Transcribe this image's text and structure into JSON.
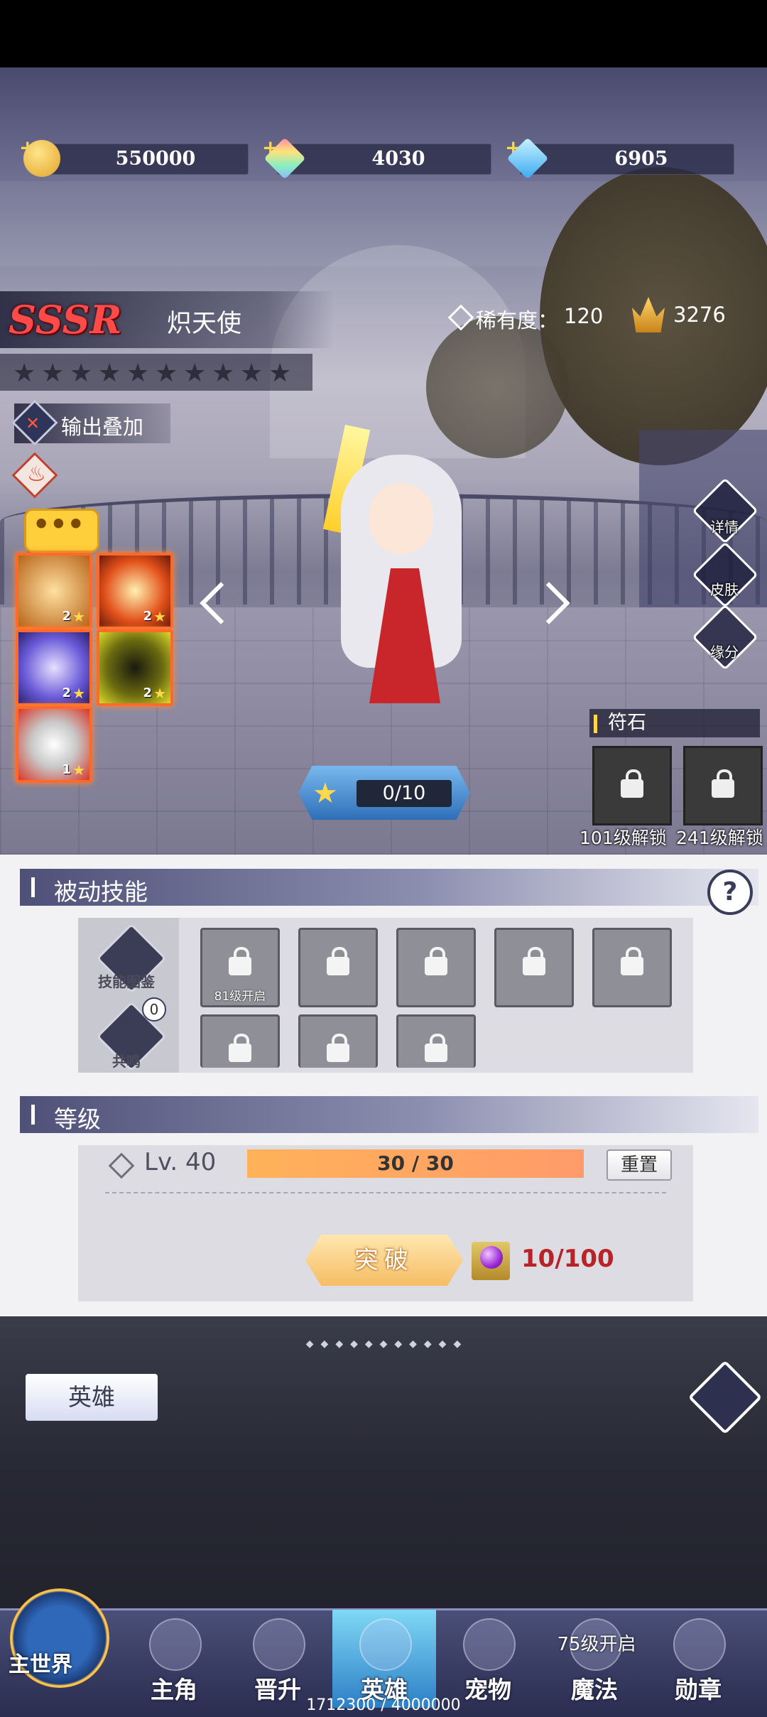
{
  "currencies": [
    {
      "name": "gold",
      "icon": "gold-coin-icon",
      "value": "550000"
    },
    {
      "name": "crystal",
      "icon": "rainbow-crystal-icon",
      "value": "4030"
    },
    {
      "name": "diamond",
      "icon": "blue-diamond-icon",
      "value": "6905"
    }
  ],
  "hero": {
    "rarity": "SSSR",
    "name": "炽天使",
    "rarity_label": "稀有度：",
    "rarity_value": "120",
    "power": "3276",
    "stars": 10,
    "tag": "输出叠加",
    "element_icon": "fire-icon"
  },
  "skills": [
    {
      "icon": "crescent-blade-icon",
      "level": "2"
    },
    {
      "icon": "flame-slash-icon",
      "level": "2"
    },
    {
      "icon": "wind-slash-icon",
      "level": "2"
    },
    {
      "icon": "shadow-aura-icon",
      "level": "2"
    },
    {
      "icon": "rose-sword-icon",
      "level": "1"
    }
  ],
  "side_menu": [
    {
      "label": "详情",
      "icon": "magnifier-icon"
    },
    {
      "label": "皮肤",
      "icon": "outfit-icon"
    },
    {
      "label": "缘分",
      "icon": "heart-icon"
    }
  ],
  "runestone": {
    "title": "符石",
    "slots": [
      {
        "label": "101级解锁"
      },
      {
        "label": "241级解锁"
      }
    ]
  },
  "exp_pill": {
    "text": "0/10"
  },
  "passive": {
    "title": "被动技能",
    "help": "?",
    "codex_label": "技能图鉴",
    "resonance_label": "共鸣",
    "resonance_count": "0",
    "slots": [
      {
        "label": "81级开启"
      },
      {
        "label": ""
      },
      {
        "label": ""
      },
      {
        "label": ""
      },
      {
        "label": ""
      },
      {
        "label": ""
      },
      {
        "label": ""
      },
      {
        "label": ""
      }
    ]
  },
  "level": {
    "title": "等级",
    "lv_text": "Lv. 40",
    "bar_text": "30 / 30",
    "progress": 1.0,
    "reset_label": "重置",
    "breakthrough_label": "突破",
    "material_count": "10/100"
  },
  "bottom": {
    "hero_tab": "英雄"
  },
  "nav": {
    "world": "主世界",
    "items": [
      {
        "label": "主角",
        "icon": "protagonist-icon"
      },
      {
        "label": "晋升",
        "icon": "promotion-icon"
      },
      {
        "label": "英雄",
        "icon": "helmet-icon",
        "active": true
      },
      {
        "label": "宠物",
        "icon": "pet-icon"
      },
      {
        "label": "魔法",
        "icon": "magic-icon",
        "lock_text": "75级开启"
      },
      {
        "label": "勋章",
        "icon": "medal-icon"
      }
    ],
    "exp_footer": "1712300 / 4000000"
  },
  "colors": {
    "rarity_red": "#ff4a4a",
    "accent_orange": "#ff6a2a",
    "material_red": "#b8232a"
  }
}
